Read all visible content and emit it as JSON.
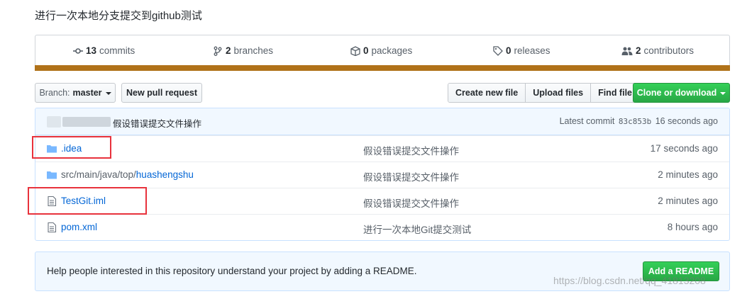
{
  "repo": {
    "description": "进行一次本地分支提交到github测试"
  },
  "summary": {
    "commits": {
      "count": "13",
      "label": "commits"
    },
    "branches": {
      "count": "2",
      "label": "branches"
    },
    "packages": {
      "count": "0",
      "label": "packages"
    },
    "releases": {
      "count": "0",
      "label": "releases"
    },
    "contributors": {
      "count": "2",
      "label": "contributors"
    },
    "language_color": "#b07219"
  },
  "toolbar": {
    "branch_prefix": "Branch:",
    "branch_name": "master",
    "new_pull_request": "New pull request",
    "create_new_file": "Create new file",
    "upload_files": "Upload files",
    "find_file": "Find file",
    "clone_or_download": "Clone or download"
  },
  "latest_commit": {
    "message": "假设错误提交文件操作",
    "label": "Latest commit",
    "sha": "83c853b",
    "age": "16 seconds ago"
  },
  "files": [
    {
      "icon": "folder-icon",
      "prefix": "",
      "name": ".idea",
      "message": "假设错误提交文件操作",
      "age": "17 seconds ago"
    },
    {
      "icon": "folder-icon",
      "prefix": "src/main/java/top/",
      "name": "huashengshu",
      "message": "假设错误提交文件操作",
      "age": "2 minutes ago"
    },
    {
      "icon": "file-icon",
      "prefix": "",
      "name": "TestGit.iml",
      "message": "假设错误提交文件操作",
      "age": "2 minutes ago"
    },
    {
      "icon": "file-icon",
      "prefix": "",
      "name": "pom.xml",
      "message": "进行一次本地Git提交测试",
      "age": "8 hours ago"
    }
  ],
  "readme": {
    "text": "Help people interested in this repository understand your project by adding a README.",
    "button": "Add a README"
  },
  "watermark": "https://blog.csdn.net/qq_41813208",
  "colors": {
    "highlight_box": "#e8323c",
    "link": "#0366d6",
    "green_button": "#28a745"
  }
}
